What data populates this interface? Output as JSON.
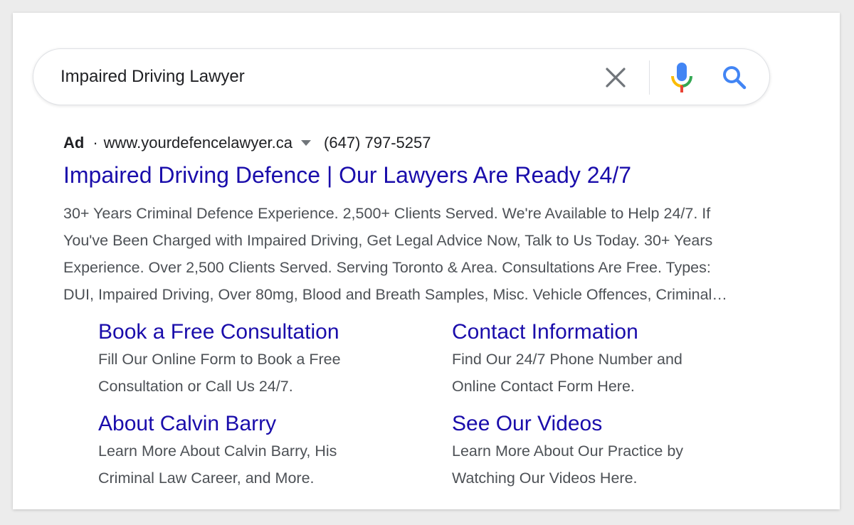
{
  "search": {
    "query": "Impaired Driving Lawyer"
  },
  "icons": {
    "clear": "close-icon",
    "mic": "microphone-icon",
    "search": "search-icon"
  },
  "colors": {
    "link": "#1a0dab",
    "text": "#202124",
    "snippet": "#4d5156",
    "mic_blue": "#4285f4",
    "mic_red": "#ea4335",
    "mic_yellow": "#fbbc05",
    "mic_green": "#34a853"
  },
  "ad": {
    "label": "Ad",
    "separator": "·",
    "url": "www.yourdefencelawyer.ca",
    "phone": "(647) 797-5257",
    "title": "Impaired Driving Defence | Our Lawyers Are Ready 24/7",
    "description_lines": [
      "30+ Years Criminal Defence Experience. 2,500+ Clients Served. We're Available to Help 24/7. If",
      "You've Been Charged with Impaired Driving, Get Legal Advice Now, Talk to Us Today. 30+ Years",
      "Experience. Over 2,500 Clients Served. Serving Toronto & Area. Consultations Are Free. Types:",
      "DUI, Impaired Driving, Over 80mg, Blood and Breath Samples, Misc. Vehicle Offences, Criminal…"
    ]
  },
  "sitelinks": [
    {
      "title": "Book a Free Consultation",
      "desc": [
        "Fill Our Online Form to Book a Free",
        "Consultation or Call Us 24/7."
      ]
    },
    {
      "title": "Contact Information",
      "desc": [
        "Find Our 24/7 Phone Number and",
        "Online Contact Form Here."
      ]
    },
    {
      "title": "About Calvin Barry",
      "desc": [
        "Learn More About Calvin Barry, His",
        "Criminal Law Career, and More."
      ]
    },
    {
      "title": "See Our Videos",
      "desc": [
        "Learn More About Our Practice by",
        "Watching Our Videos Here."
      ]
    }
  ]
}
